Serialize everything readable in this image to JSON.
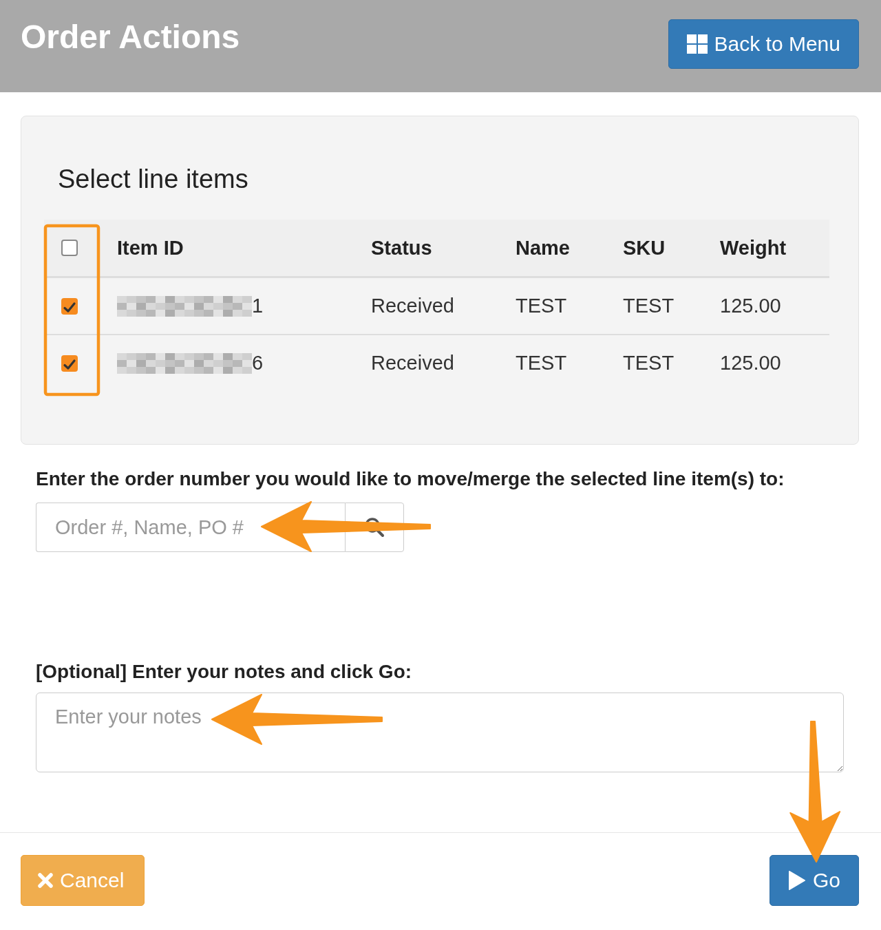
{
  "header": {
    "title": "Order Actions",
    "back_button": "Back to Menu"
  },
  "panel": {
    "title": "Select line items",
    "table": {
      "select_all": {
        "checked": false
      },
      "columns": [
        "Item ID",
        "Status",
        "Name",
        "SKU",
        "Weight"
      ],
      "rows": [
        {
          "checked": true,
          "redacted": true,
          "cells": [
            "1",
            "Received",
            "TEST",
            "TEST",
            "125.00"
          ]
        },
        {
          "checked": true,
          "redacted": true,
          "cells": [
            "6",
            "Received",
            "TEST",
            "TEST",
            "125.00"
          ]
        }
      ]
    }
  },
  "order_field": {
    "label": "Enter the order number you would like to move/merge the selected line item(s) to:",
    "placeholder": "Order #, Name, PO #"
  },
  "notes_field": {
    "label": "[Optional] Enter your notes and click Go:",
    "placeholder": "Enter your notes"
  },
  "footer": {
    "cancel": "Cancel",
    "go": "Go"
  },
  "annotations": [
    {
      "kind": "highlight"
    },
    {
      "kind": "arrow"
    },
    {
      "kind": "arrow"
    },
    {
      "kind": "arrow"
    }
  ]
}
